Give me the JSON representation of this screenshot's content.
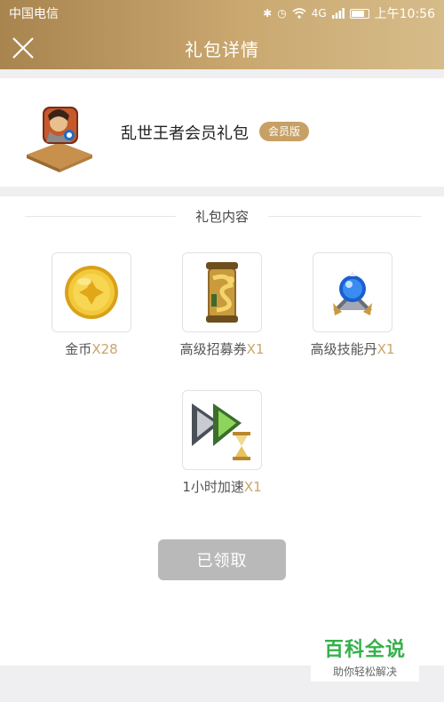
{
  "status_bar": {
    "carrier": "中国电信",
    "time": "上午10:56",
    "network": "4G"
  },
  "header": {
    "title": "礼包详情",
    "close_icon": "close-icon"
  },
  "gift": {
    "game_name": "乱世王者会员礼包",
    "badge": "会员版"
  },
  "content": {
    "section_title": "礼包内容",
    "items": [
      {
        "name": "金币",
        "qty": "X28",
        "icon": "gold-coin-icon"
      },
      {
        "name": "高级招募券",
        "qty": "X1",
        "icon": "recruit-scroll-icon"
      },
      {
        "name": "高级技能丹",
        "qty": "X1",
        "icon": "skill-gem-icon"
      },
      {
        "name": "1小时加速",
        "qty": "X1",
        "icon": "speedup-icon"
      }
    ],
    "claim_button": "已领取"
  },
  "watermark": {
    "title": "百科全说",
    "subtitle": "助你轻松解决"
  },
  "colors": {
    "gold_accent": "#c7a066",
    "header_start": "#a8844e",
    "header_end": "#d6bc8a",
    "disabled_button": "#b9b9b9"
  }
}
